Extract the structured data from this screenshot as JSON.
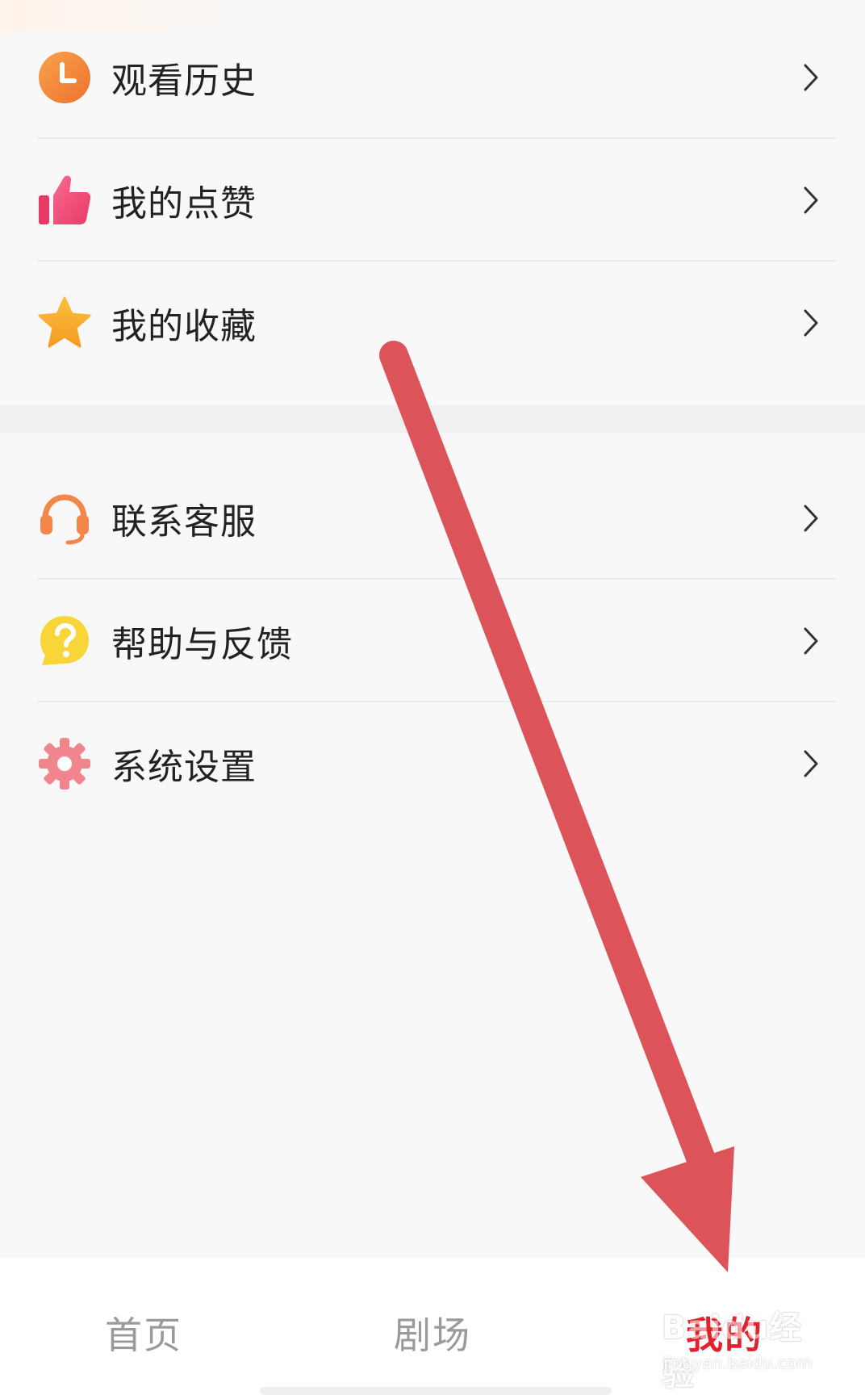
{
  "menu_group_1": {
    "items": [
      {
        "label": "观看历史",
        "icon": "clock-icon"
      },
      {
        "label": "我的点赞",
        "icon": "thumbs-up-icon"
      },
      {
        "label": "我的收藏",
        "icon": "star-icon"
      }
    ]
  },
  "menu_group_2": {
    "items": [
      {
        "label": "联系客服",
        "icon": "headset-icon"
      },
      {
        "label": "帮助与反馈",
        "icon": "help-bubble-icon"
      },
      {
        "label": "系统设置",
        "icon": "gear-icon"
      }
    ]
  },
  "tabbar": {
    "tabs": [
      {
        "label": "首页",
        "active": false
      },
      {
        "label": "剧场",
        "active": false
      },
      {
        "label": "我的",
        "active": true
      }
    ]
  },
  "watermark": {
    "main": "Baidu经验",
    "sub": "jingyan.baidu.com"
  },
  "annotation": {
    "type": "arrow",
    "color": "#dc5359",
    "points_to": "tab-mine"
  },
  "colors": {
    "active_tab": "#e0222e",
    "inactive_tab": "#9a9a9a",
    "clock": "#f08a3a",
    "thumbs_up": "#ef4f7a",
    "star": "#f7b12d",
    "headset": "#f3874a",
    "help": "#f8d63a",
    "gear": "#f1858e"
  }
}
